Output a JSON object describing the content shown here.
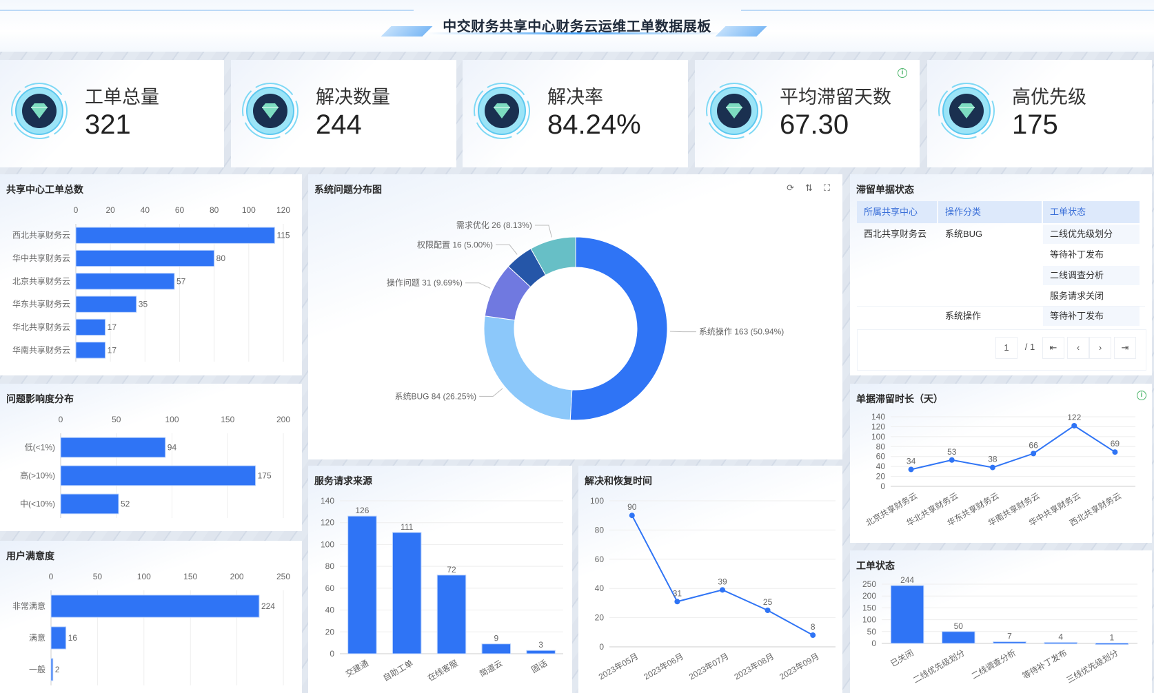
{
  "header": {
    "title": "中交财务共享中心财务云运维工单数据展板"
  },
  "kpis": [
    {
      "label": "工单总量",
      "value": "321",
      "icon": "diamond-icon"
    },
    {
      "label": "解决数量",
      "value": "244",
      "icon": "diamond-icon"
    },
    {
      "label": "解决率",
      "value": "84.24%",
      "icon": "diamond-icon"
    },
    {
      "label": "平均滞留天数",
      "value": "67.30",
      "icon": "diamond-icon",
      "info": "i"
    },
    {
      "label": "高优先级",
      "value": "175",
      "icon": "diamond-icon"
    }
  ],
  "colors": {
    "bar": "#2f74f5",
    "text": "#666666",
    "grid": "#eeeeee"
  },
  "panels": {
    "center_total": "共享中心工单总数",
    "pie": "系统问题分布图",
    "table": "滞留单据状态",
    "impact": "问题影响度分布",
    "satisfaction": "用户满意度",
    "source": "服务请求来源",
    "resolve": "解决和恢复时间",
    "stay": "单据滞留时长（天）",
    "status": "工单状态"
  },
  "pie_tools": {
    "refresh": "⟳",
    "sort": "⇅",
    "fullscreen": "⛶"
  },
  "table": {
    "headers": [
      "所属共享中心",
      "操作分类",
      "工单状态"
    ],
    "rows": [
      {
        "center": "西北共享财务云",
        "category": "系统BUG",
        "statuses": [
          "二线优先级划分",
          "等待补丁发布",
          "二线调查分析",
          "服务请求关闭"
        ]
      },
      {
        "center": "",
        "category": "系统操作",
        "statuses": [
          "等待补丁发布"
        ]
      }
    ],
    "pager": {
      "page": "1",
      "total": "/ 1",
      "first": "⇤",
      "prev": "‹",
      "next": "›",
      "last": "⇥"
    }
  },
  "chart_data": [
    {
      "id": "center_total",
      "type": "bar",
      "orientation": "horizontal",
      "title": "共享中心工单总数",
      "categories": [
        "西北共享财务云",
        "华中共享财务云",
        "北京共享财务云",
        "华东共享财务云",
        "华北共享财务云",
        "华南共享财务云"
      ],
      "values": [
        115,
        80,
        57,
        35,
        17,
        17
      ],
      "xlim": [
        0,
        120
      ],
      "ticks": [
        0,
        20,
        40,
        60,
        80,
        100,
        120
      ]
    },
    {
      "id": "impact",
      "type": "bar",
      "orientation": "horizontal",
      "title": "问题影响度分布",
      "categories": [
        "低(<1%)",
        "高(>10%)",
        "中(<10%)"
      ],
      "values": [
        94,
        175,
        52
      ],
      "xlim": [
        0,
        200
      ],
      "ticks": [
        0,
        50,
        100,
        150,
        200
      ]
    },
    {
      "id": "satisfaction",
      "type": "bar",
      "orientation": "horizontal",
      "title": "用户满意度",
      "categories": [
        "非常满意",
        "满意",
        "一般"
      ],
      "values": [
        224,
        16,
        2
      ],
      "xlim": [
        0,
        250
      ],
      "ticks": [
        0,
        50,
        100,
        150,
        200,
        250
      ]
    },
    {
      "id": "pie",
      "type": "pie",
      "title": "系统问题分布图",
      "categories": [
        "系统操作",
        "系统BUG",
        "操作问题",
        "权限配置",
        "需求优化"
      ],
      "values": [
        163,
        84,
        31,
        16,
        26
      ],
      "percents": [
        "50.94%",
        "26.25%",
        "9.69%",
        "5.00%",
        "8.13%"
      ],
      "colors": [
        "#2f74f5",
        "#8cc8fa",
        "#7079e0",
        "#2556a8",
        "#67bfc6"
      ]
    },
    {
      "id": "source",
      "type": "bar",
      "orientation": "vertical",
      "title": "服务请求来源",
      "categories": [
        "交建通",
        "自助工单",
        "在线客服",
        "简道云",
        "固话"
      ],
      "values": [
        126,
        111,
        72,
        9,
        3
      ],
      "ylim": [
        0,
        140
      ],
      "ticks": [
        0,
        20,
        40,
        60,
        80,
        100,
        120,
        140
      ]
    },
    {
      "id": "resolve",
      "type": "line",
      "title": "解决和恢复时间",
      "categories": [
        "2023年05月",
        "2023年06月",
        "2023年07月",
        "2023年08月",
        "2023年09月"
      ],
      "values": [
        90,
        31,
        39,
        25,
        8
      ],
      "ylim": [
        0,
        100
      ],
      "ticks": [
        0,
        20,
        40,
        60,
        80,
        100
      ]
    },
    {
      "id": "stay",
      "type": "line",
      "title": "单据滞留时长（天）",
      "categories": [
        "北京共享财务云",
        "华北共享财务云",
        "华东共享财务云",
        "华南共享财务云",
        "华中共享财务云",
        "西北共享财务云"
      ],
      "values": [
        34,
        53,
        38,
        66,
        122,
        69
      ],
      "ylim": [
        0,
        140
      ],
      "ticks": [
        0,
        20,
        40,
        60,
        80,
        100,
        120,
        140
      ]
    },
    {
      "id": "status",
      "type": "bar",
      "orientation": "vertical",
      "title": "工单状态",
      "categories": [
        "已关闭",
        "二线优先级划分",
        "二线调查分析",
        "等待补丁发布",
        "三线优先级划分"
      ],
      "values": [
        244,
        50,
        7,
        4,
        1
      ],
      "ylim": [
        0,
        250
      ],
      "ticks": [
        0,
        50,
        100,
        150,
        200,
        250
      ]
    }
  ]
}
